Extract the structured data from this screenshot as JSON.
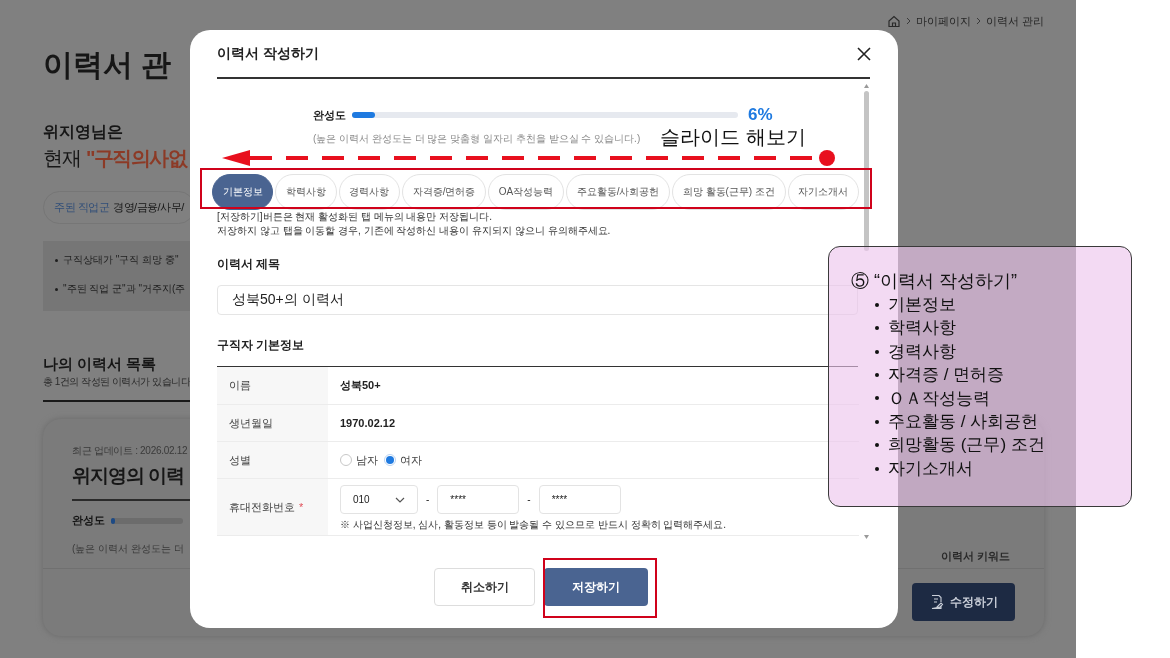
{
  "page": {
    "breadcrumb": [
      "마이페이지",
      "이력서 관리"
    ],
    "title": "이력서 관",
    "greeting": "위지영님은",
    "status": {
      "prefix": "현재",
      "highlight": "\"구직의사없"
    },
    "job_group": {
      "label": "주된 직업군",
      "value": "경영/금융/사무/"
    },
    "notices": [
      "구직상태가 \"구직 희망 중\"",
      "\"주된 직업 군\"과 \"거주지(주"
    ],
    "list_title": "나의 이력서 목록",
    "list_count": "총 1건의 작성된 이력서가 있습니다",
    "card": {
      "updated": "최근 업데이트 : 2026.02.12",
      "title": "위지영의 이력",
      "progress_label": "완성도",
      "level": 0.06,
      "note": "(높은 이력서 완성도는 더",
      "keyword_label": "이력서 키워드",
      "edit_button": "수정하기"
    }
  },
  "modal": {
    "title": "이력서 작성하기",
    "progress": {
      "label": "완성도",
      "level": 0.06,
      "percent": "6%",
      "note": "(높은 이력서 완성도는 더 많은 맞춤형 일자리 추천을 받으실 수 있습니다.)"
    },
    "tabs": [
      {
        "label": "기본정보",
        "selected": true
      },
      {
        "label": "학력사항",
        "selected": false
      },
      {
        "label": "경력사항",
        "selected": false
      },
      {
        "label": "자격증/면허증",
        "selected": false
      },
      {
        "label": "OA작성능력",
        "selected": false
      },
      {
        "label": "주요활동/사회공헌",
        "selected": false
      },
      {
        "label": "희망 활동(근무) 조건",
        "selected": false
      },
      {
        "label": "자기소개서",
        "selected": false
      }
    ],
    "notice": [
      "[저장하기]버튼은 현재 활성화된 탭 메뉴의 내용만 저장됩니다.",
      "저장하지 않고 탭을 이동할 경우, 기존에 작성하신 내용이 유지되지 않으니 유의해주세요."
    ],
    "resume_title": {
      "label": "이력서 제목",
      "value": "성북50+의 이력서"
    },
    "basic_info": {
      "heading": "구직자 기본정보",
      "rows": [
        {
          "label": "이름",
          "kind": "text",
          "value": "성북50+"
        },
        {
          "label": "생년월일",
          "kind": "text",
          "value": "1970.02.12"
        },
        {
          "label": "성별",
          "kind": "radio",
          "options": [
            {
              "label": "남자",
              "selected": false
            },
            {
              "label": "여자",
              "selected": true
            }
          ]
        },
        {
          "label": "휴대전화번호",
          "required_mark": "*",
          "kind": "phone",
          "parts": [
            {
              "kind": "select",
              "value": "010"
            },
            {
              "kind": "separator",
              "text": "-"
            },
            {
              "kind": "input",
              "value": "****"
            },
            {
              "kind": "separator",
              "text": "-"
            },
            {
              "kind": "input",
              "value": "****"
            }
          ],
          "note": "※ 사업신청정보, 심사, 활동정보 등이 발송될 수 있으므로 반드시 정확히 입력해주세요."
        }
      ]
    },
    "buttons": [
      {
        "label": "취소하기",
        "kind": "secondary"
      },
      {
        "label": "저장하기",
        "kind": "primary"
      }
    ]
  },
  "annotations": {
    "slide_hint": "슬라이드 해보기",
    "callout": {
      "title": "⑤ “이력서 작성하기”",
      "items": [
        "기본정보",
        "학력사항",
        "경력사항",
        "자격증 / 면허증",
        "ＯＡ작성능력",
        "주요활동 / 사회공헌",
        "희망활동 (근무) 조건",
        "자기소개서"
      ]
    }
  }
}
